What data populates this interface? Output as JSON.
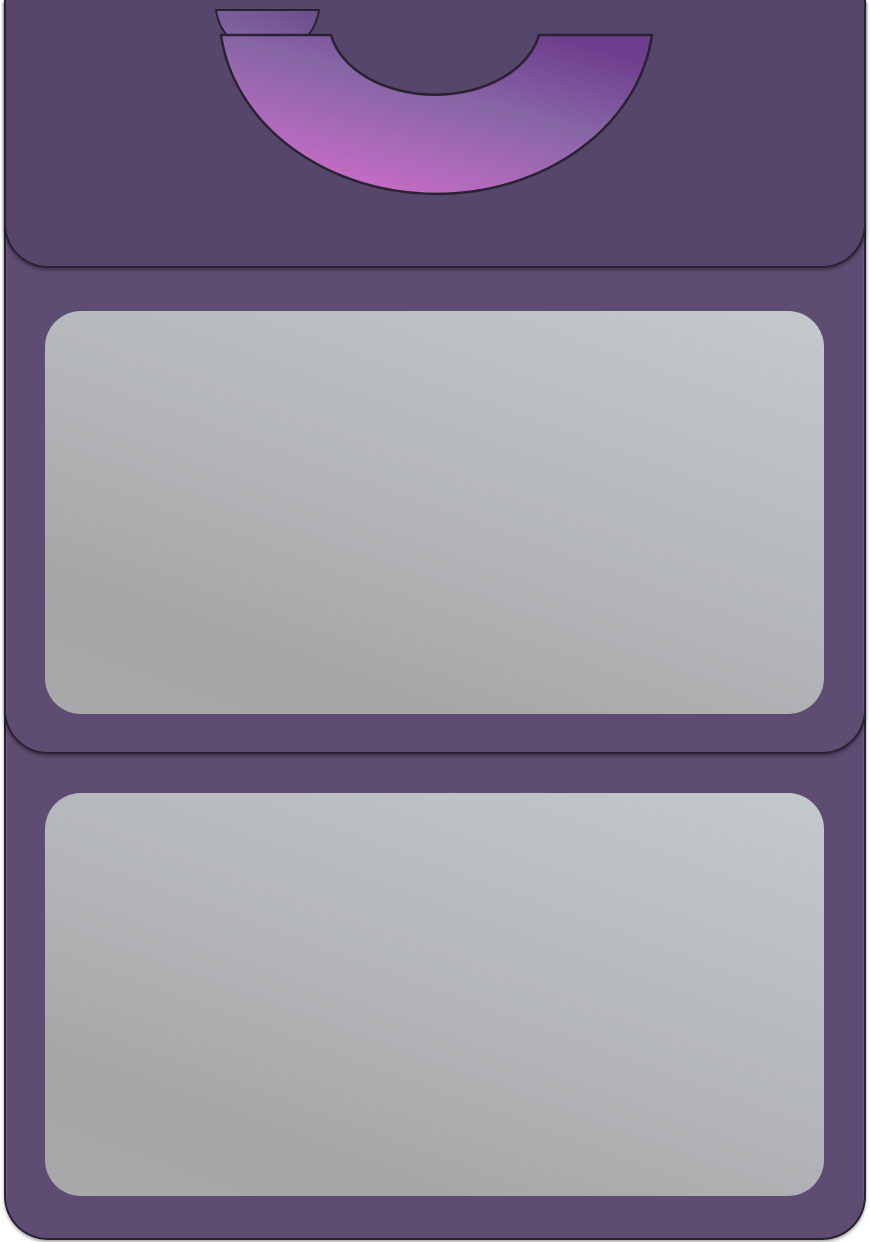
{
  "theme": {
    "frame_color": "#5e4c73",
    "header_color": "#56466b",
    "outline_color": "#2a2233",
    "accent_gradient": [
      "#c46cc4",
      "#7f64a2",
      "#6e3d8d"
    ],
    "panel_gradient": [
      "#c3c9cd",
      "#a6a6a7"
    ]
  },
  "icons": {
    "header_emblem": "half-ring-cup-icon"
  },
  "panels": [
    {
      "id": "panel-1",
      "content": ""
    },
    {
      "id": "panel-2",
      "content": ""
    }
  ]
}
